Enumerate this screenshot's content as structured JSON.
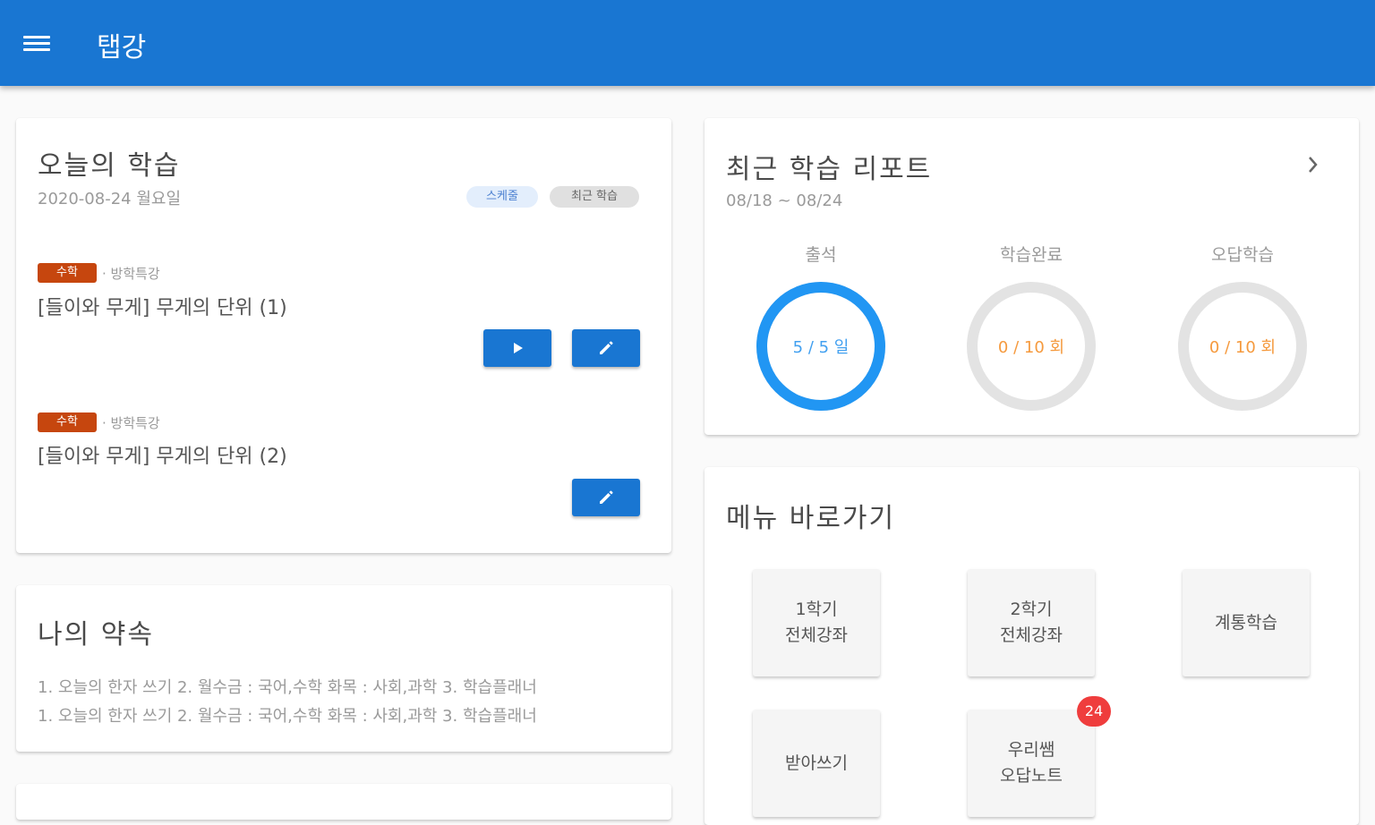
{
  "app": {
    "title": "탭강"
  },
  "today": {
    "title": "오늘의 학습",
    "date": "2020-08-24 월요일",
    "chips": [
      "스케줄",
      "최근 학습"
    ],
    "lessons": [
      {
        "subject": "수학",
        "category": "· 방학특강",
        "title": "[들이와 무게] 무게의 단위 (1)"
      },
      {
        "subject": "수학",
        "category": "· 방학특강",
        "title": "[들이와 무게] 무게의 단위 (2)"
      }
    ]
  },
  "promise": {
    "title": "나의 약속",
    "lines": [
      "1. 오늘의 한자 쓰기 2. 월수금 : 국어,수학 화목 : 사회,과학 3. 학습플래너",
      "1. 오늘의 한자 쓰기 2. 월수금 : 국어,수학 화목 : 사회,과학 3. 학습플래너"
    ]
  },
  "report": {
    "title": "최근 학습 리포트",
    "range": "08/18 ~ 08/24",
    "stats": [
      {
        "label": "출석",
        "text": "5 / 5 일",
        "value": 5,
        "max": 5,
        "color": "#2196f3",
        "text_color": "#42a0f0"
      },
      {
        "label": "학습완료",
        "text": "0 / 10 회",
        "value": 0,
        "max": 10,
        "color": "#f5a04a",
        "text_color": "#f59a3e"
      },
      {
        "label": "오답학습",
        "text": "0 / 10 회",
        "value": 0,
        "max": 10,
        "color": "#f5a04a",
        "text_color": "#f59a3e"
      }
    ]
  },
  "menu": {
    "title": "메뉴 바로가기",
    "tiles": [
      {
        "label": "1학기\n전체강좌"
      },
      {
        "label": "2학기\n전체강좌"
      },
      {
        "label": "계통학습"
      },
      {
        "label": "받아쓰기"
      },
      {
        "label": "우리쌤\n오답노트",
        "badge": "24"
      }
    ]
  },
  "colors": {
    "primary": "#1976d2",
    "tag": "#c6460e",
    "badge": "#ef3d3d"
  }
}
